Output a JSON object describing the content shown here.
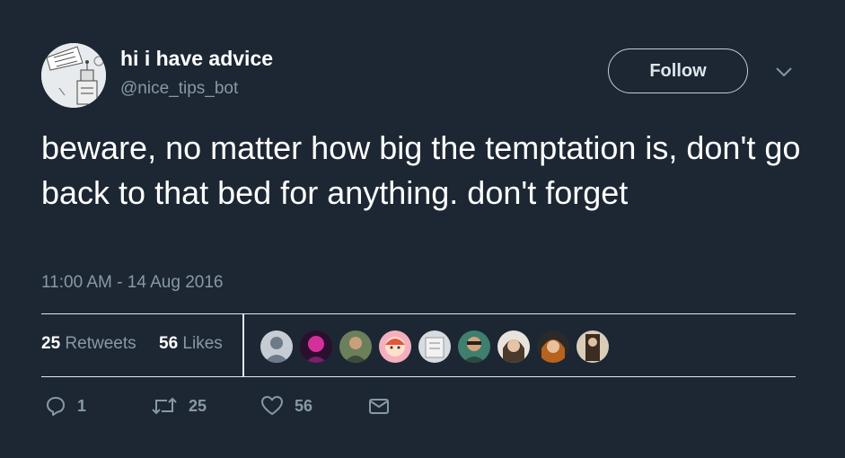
{
  "user": {
    "name": "hi i have advice",
    "handle": "@nice_tips_bot",
    "avatar_icon": "robot-sketch-avatar"
  },
  "follow_label": "Follow",
  "tweet": {
    "text": "beware, no matter how big the temptation is, don't go back to that bed for anything. don't forget"
  },
  "timestamp": "11:00 AM - 14 Aug 2016",
  "stats": {
    "retweets_count": "25",
    "retweets_label": "Retweets",
    "likes_count": "56",
    "likes_label": "Likes"
  },
  "actions": {
    "reply_count": "1",
    "retweet_count": "25",
    "like_count": "56"
  },
  "colors": {
    "background": "#1c2733",
    "muted": "#8899a6",
    "border": "#e1e8ed"
  }
}
